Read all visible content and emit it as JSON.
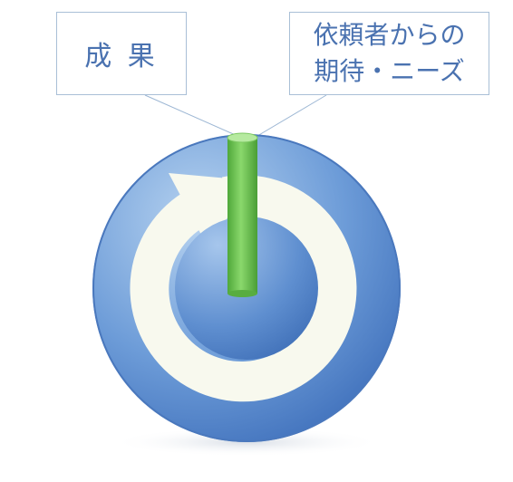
{
  "labels": {
    "left": "成 果",
    "right_line1": "依頼者からの",
    "right_line2": "期待・ニーズ"
  },
  "colors": {
    "label_text": "#4a72b0",
    "label_border": "#a9bfd6",
    "disc_light": "#a9c8ea",
    "disc_dark": "#3e70bb",
    "ring": "#f8f9ee",
    "pillar": "#6cc14f"
  },
  "icons": {
    "cycle": "circular-arrow-icon",
    "pillar": "green-cylinder-icon"
  }
}
